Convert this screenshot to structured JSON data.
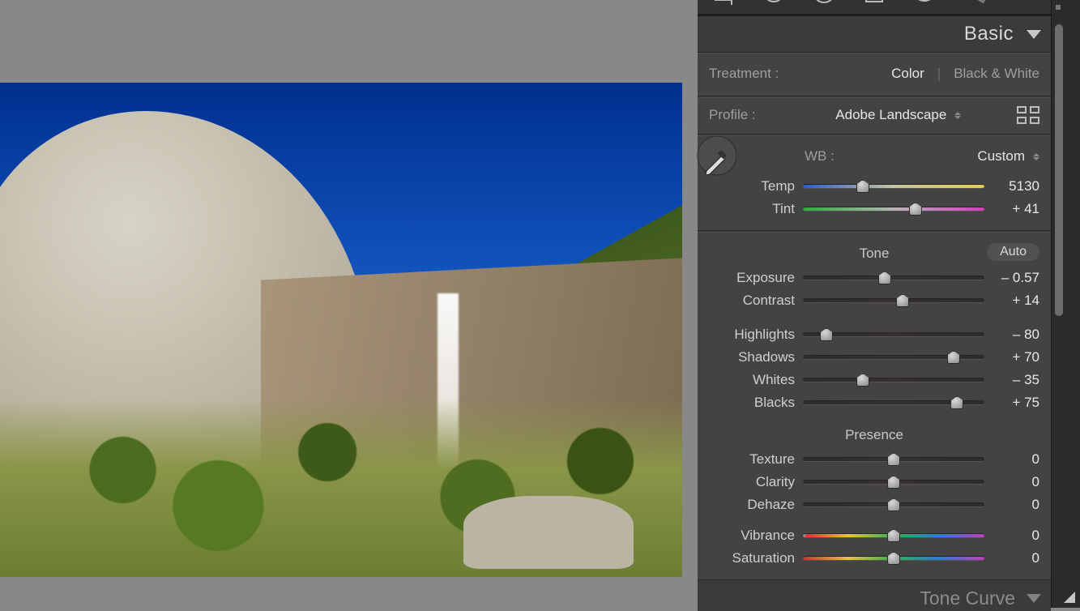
{
  "panels": {
    "basic": {
      "title": "Basic",
      "treatment_label": "Treatment :",
      "treatment_color": "Color",
      "treatment_bw": "Black & White",
      "profile_label": "Profile :",
      "profile_value": "Adobe Landscape",
      "wb_label": "WB :",
      "wb_value": "Custom",
      "sliders": {
        "temp": {
          "label": "Temp",
          "value": "5130",
          "pos": 33
        },
        "tint": {
          "label": "Tint",
          "value": "+ 41",
          "pos": 62
        },
        "exposure": {
          "label": "Exposure",
          "value": "– 0.57",
          "pos": 45
        },
        "contrast": {
          "label": "Contrast",
          "value": "+ 14",
          "pos": 55
        },
        "highlights": {
          "label": "Highlights",
          "value": "– 80",
          "pos": 13
        },
        "shadows": {
          "label": "Shadows",
          "value": "+ 70",
          "pos": 83
        },
        "whites": {
          "label": "Whites",
          "value": "– 35",
          "pos": 33
        },
        "blacks": {
          "label": "Blacks",
          "value": "+ 75",
          "pos": 85
        },
        "texture": {
          "label": "Texture",
          "value": "0",
          "pos": 50
        },
        "clarity": {
          "label": "Clarity",
          "value": "0",
          "pos": 50
        },
        "dehaze": {
          "label": "Dehaze",
          "value": "0",
          "pos": 50
        },
        "vibrance": {
          "label": "Vibrance",
          "value": "0",
          "pos": 50
        },
        "saturation": {
          "label": "Saturation",
          "value": "0",
          "pos": 50
        }
      },
      "tone_label": "Tone",
      "auto_label": "Auto",
      "presence_label": "Presence"
    },
    "tonecurve": {
      "title": "Tone Curve"
    }
  }
}
